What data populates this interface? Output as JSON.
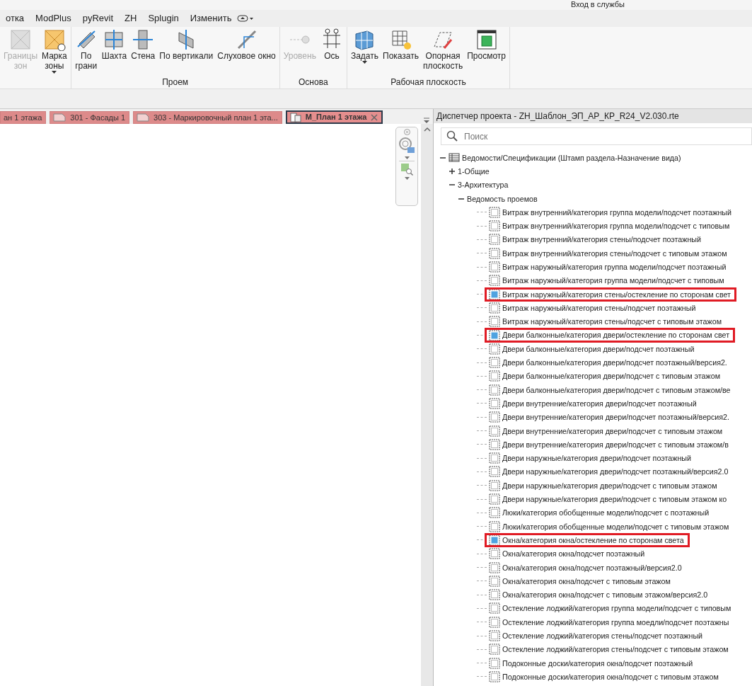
{
  "title_bar": {
    "text": "Вход в службы"
  },
  "menu": [
    {
      "label": "отка"
    },
    {
      "label": "ModPlus"
    },
    {
      "label": "pyRevit"
    },
    {
      "label": "ZH"
    },
    {
      "label": "Splugin"
    },
    {
      "label": "Изменить"
    }
  ],
  "ribbon": {
    "groups": [
      {
        "buttons": [
          {
            "label": "Границы\nзон",
            "disabled": true,
            "dropdown": false
          },
          {
            "label": "Марка\nзоны",
            "disabled": false,
            "dropdown": true
          }
        ]
      },
      {
        "label": "Проем",
        "buttons": [
          {
            "label": "По\nграни",
            "disabled": false,
            "dropdown": false
          },
          {
            "label": "Шахта",
            "disabled": false,
            "dropdown": false
          },
          {
            "label": "Стена",
            "disabled": false,
            "dropdown": false
          },
          {
            "label": "По вертикали",
            "disabled": false,
            "dropdown": false
          },
          {
            "label": "Слуховое окно",
            "disabled": false,
            "dropdown": false
          }
        ]
      },
      {
        "label": "Основа",
        "buttons": [
          {
            "label": "Уровень",
            "disabled": true,
            "dropdown": false
          },
          {
            "label": "Ось",
            "disabled": false,
            "dropdown": false
          }
        ]
      },
      {
        "label": "Рабочая плоскость",
        "buttons": [
          {
            "label": "Задать",
            "disabled": false,
            "dropdown": true
          },
          {
            "label": "Показать",
            "disabled": false,
            "dropdown": false
          },
          {
            "label": "Опорная\nплоскость",
            "disabled": false,
            "dropdown": false
          },
          {
            "label": "Просмотр",
            "disabled": false,
            "dropdown": false
          }
        ]
      }
    ]
  },
  "view_tabs": [
    {
      "label": "ан 1 этажа",
      "selected": false
    },
    {
      "label": "301 - Фасады 1",
      "selected": false
    },
    {
      "label": "303 - Маркировочный план 1 эта...",
      "selected": false
    },
    {
      "label": "М_План 1 этажа",
      "selected": true
    }
  ],
  "project_browser": {
    "title": "Диспетчер проекта - ZH_Шаблон_ЭП_АР_КР_R24_V2.030.rte",
    "search": {
      "placeholder": "Поиск"
    },
    "tree": [
      {
        "label": "Ведомости/Спецификации (Штамп раздела-Назначение вида)",
        "kind": "folder",
        "expanded": true,
        "children": [
          {
            "label": "1-Общие",
            "kind": "group",
            "expanded": false
          },
          {
            "label": "3-Архитектура",
            "kind": "group",
            "expanded": true,
            "children": [
              {
                "label": "Ведомость проемов",
                "kind": "group",
                "expanded": true,
                "children": [
                  {
                    "label": "Витраж внутренний/категория группа модели/подсчет поэтажный",
                    "kind": "schedule",
                    "highlighted": false
                  },
                  {
                    "label": "Витраж внутренний/категория группа модели/подсчет с типовым",
                    "kind": "schedule",
                    "highlighted": false
                  },
                  {
                    "label": "Витраж внутренний/категория стены/подсчет поэтажный",
                    "kind": "schedule",
                    "highlighted": false
                  },
                  {
                    "label": "Витраж внутренний/категория стены/подсчет с типовым этажом",
                    "kind": "schedule",
                    "highlighted": false
                  },
                  {
                    "label": "Витраж наружный/категория группа модели/подсчет поэтажный",
                    "kind": "schedule",
                    "highlighted": false
                  },
                  {
                    "label": "Витраж наружный/категория группа модели/подсчет с типовым",
                    "kind": "schedule",
                    "highlighted": false
                  },
                  {
                    "label": "Витраж наружный/категория стены/остекление по сторонам свет",
                    "kind": "schedule",
                    "highlighted": true
                  },
                  {
                    "label": "Витраж наружный/категория стены/подсчет поэтажный",
                    "kind": "schedule",
                    "highlighted": false
                  },
                  {
                    "label": "Витраж наружный/категория стены/подсчет с типовым этажом",
                    "kind": "schedule",
                    "highlighted": false
                  },
                  {
                    "label": "Двери балконные/категория двери/остекление по сторонам свет",
                    "kind": "schedule",
                    "highlighted": true
                  },
                  {
                    "label": "Двери балконные/категория двери/подсчет поэтажный",
                    "kind": "schedule",
                    "highlighted": false
                  },
                  {
                    "label": "Двери балконные/категория двери/подсчет поэтажный/версия2.",
                    "kind": "schedule",
                    "highlighted": false
                  },
                  {
                    "label": "Двери балконные/категория двери/подсчет с типовым этажом",
                    "kind": "schedule",
                    "highlighted": false
                  },
                  {
                    "label": "Двери балконные/категория двери/подсчет с типовым этажом/ве",
                    "kind": "schedule",
                    "highlighted": false
                  },
                  {
                    "label": "Двери внутренние/категория двери/подсчет поэтажный",
                    "kind": "schedule",
                    "highlighted": false
                  },
                  {
                    "label": "Двери внутренние/категория двери/подсчет поэтажный/версия2.",
                    "kind": "schedule",
                    "highlighted": false
                  },
                  {
                    "label": "Двери внутренние/категория двери/подсчет с типовым этажом",
                    "kind": "schedule",
                    "highlighted": false
                  },
                  {
                    "label": "Двери внутренние/категория двери/подсчет с типовым этажом/в",
                    "kind": "schedule",
                    "highlighted": false
                  },
                  {
                    "label": "Двери наружные/категория двери/подсчет поэтажный",
                    "kind": "schedule",
                    "highlighted": false
                  },
                  {
                    "label": "Двери наружные/категория двери/подсчет поэтажный/версия2.0",
                    "kind": "schedule",
                    "highlighted": false
                  },
                  {
                    "label": "Двери наружные/категория двери/подсчет с типовым этажом",
                    "kind": "schedule",
                    "highlighted": false
                  },
                  {
                    "label": "Двери наружные/категория двери/подсчет с типовым этажом ко",
                    "kind": "schedule",
                    "highlighted": false
                  },
                  {
                    "label": "Люки/категория обобщенные модели/подсчет с поэтажный",
                    "kind": "schedule",
                    "highlighted": false
                  },
                  {
                    "label": "Люки/категория обобщенные модели/подсчет с типовым этажом",
                    "kind": "schedule",
                    "highlighted": false
                  },
                  {
                    "label": "Окна/категория окна/остекление по сторонам света",
                    "kind": "schedule",
                    "highlighted": true
                  },
                  {
                    "label": "Окна/категория окна/подсчет поэтажный",
                    "kind": "schedule",
                    "highlighted": false
                  },
                  {
                    "label": "Окна/категория окна/подсчет поэтажный/версия2.0",
                    "kind": "schedule",
                    "highlighted": false
                  },
                  {
                    "label": "Окна/категория окна/подсчет с типовым этажом",
                    "kind": "schedule",
                    "highlighted": false
                  },
                  {
                    "label": "Окна/категория окна/подсчет с типовым этажом/версия2.0",
                    "kind": "schedule",
                    "highlighted": false
                  },
                  {
                    "label": "Остекление лоджий/категория группа модели/подсчет с типовым",
                    "kind": "schedule",
                    "highlighted": false
                  },
                  {
                    "label": "Остекление лоджий/категория группа моедли/подсчет поэтажны",
                    "kind": "schedule",
                    "highlighted": false
                  },
                  {
                    "label": "Остекление лоджий/категория стены/подсчет поэтажный",
                    "kind": "schedule",
                    "highlighted": false
                  },
                  {
                    "label": "Остекление лоджий/категория стены/подсчет с типовым этажом",
                    "kind": "schedule",
                    "highlighted": false
                  },
                  {
                    "label": "Подоконные доски/категория окна/подсчет поэтажный",
                    "kind": "schedule",
                    "highlighted": false
                  },
                  {
                    "label": "Подоконные доски/категория окна/подсчет с типовым этажом",
                    "kind": "schedule",
                    "highlighted": false
                  }
                ]
              }
            ]
          }
        ]
      }
    ]
  }
}
